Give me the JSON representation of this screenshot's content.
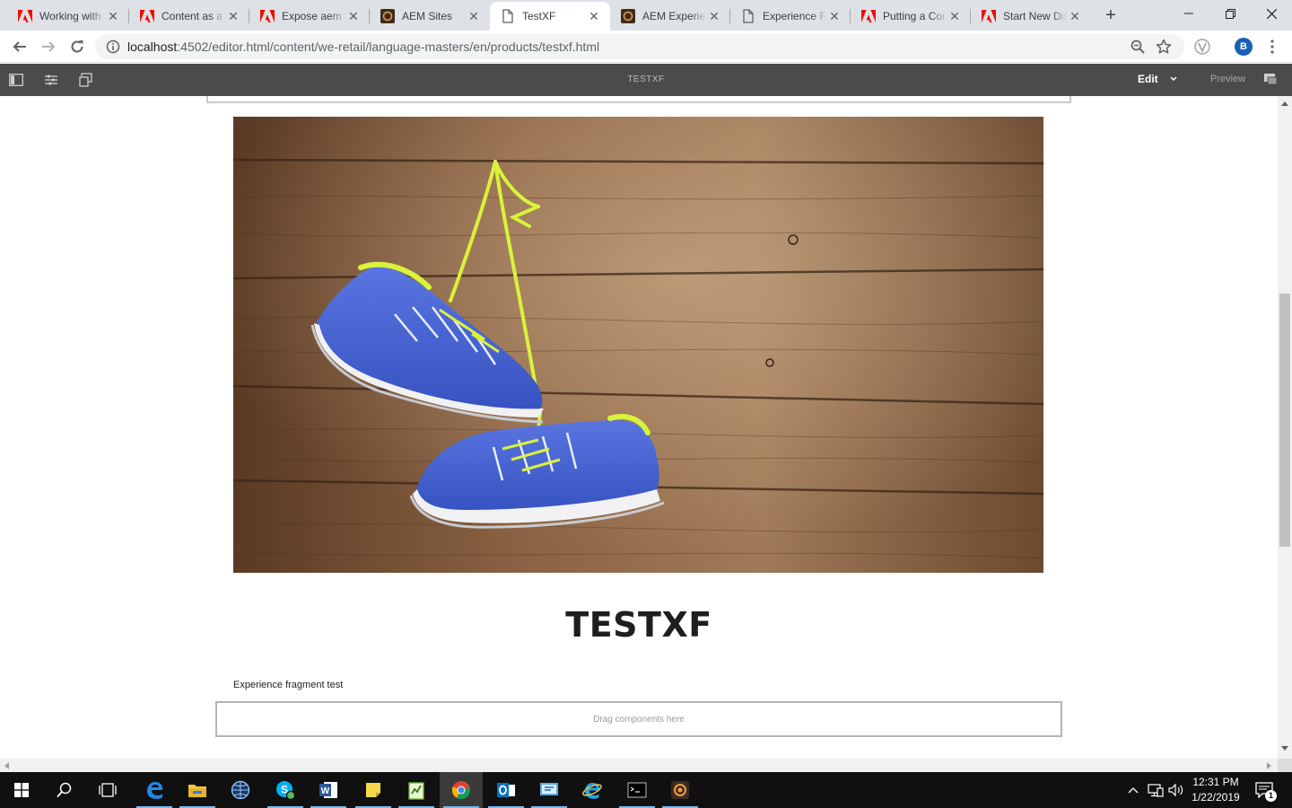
{
  "browser": {
    "tabs": [
      {
        "title": "Working with",
        "favicon": "adobe-icon"
      },
      {
        "title": "Content as a",
        "favicon": "adobe-icon"
      },
      {
        "title": "Expose aem a",
        "favicon": "adobe-icon"
      },
      {
        "title": "AEM Sites",
        "favicon": "aem-icon"
      },
      {
        "title": "TestXF",
        "favicon": "page-icon",
        "active": true
      },
      {
        "title": "AEM Experie",
        "favicon": "aem-icon"
      },
      {
        "title": "Experience Fr",
        "favicon": "page-icon"
      },
      {
        "title": "Putting a Cor",
        "favicon": "adobe-icon"
      },
      {
        "title": "Start New Dis",
        "favicon": "adobe-icon"
      }
    ],
    "url_host": "localhost",
    "url_path": ":4502/editor.html/content/we-retail/language-masters/en/products/testxf.html",
    "profile_initial": "B"
  },
  "editor": {
    "page_title": "TESTXF",
    "mode_label": "Edit",
    "preview_label": "Preview"
  },
  "content": {
    "xf_title": "TESTXF",
    "xf_text": "Experience fragment test",
    "dropzone_label": "Drag components here"
  },
  "taskbar": {
    "time": "12:31 PM",
    "date": "1/22/2019",
    "notification_count": "1"
  },
  "colors": {
    "editor_bar": "#4b4b4b",
    "adobe_red": "#eb1000",
    "taskbar": "#101010"
  }
}
